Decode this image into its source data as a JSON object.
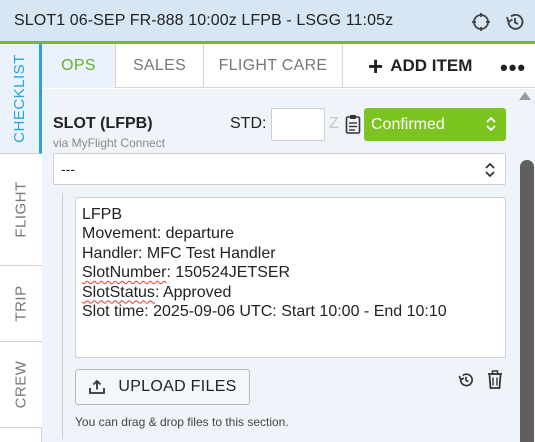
{
  "header": {
    "title": "SLOT1  06-SEP  FR-888 10:00z LFPB - LSGG 11:05z",
    "icons": [
      "crosshair-icon",
      "history-icon"
    ],
    "accent_color": "#7cb342"
  },
  "side_tabs": [
    {
      "label": "CHECKLIST",
      "active": true
    },
    {
      "label": "FLIGHT",
      "active": false
    },
    {
      "label": "TRIP",
      "active": false
    },
    {
      "label": "CREW",
      "active": false
    }
  ],
  "top_tabs": [
    {
      "label": "OPS",
      "active": true
    },
    {
      "label": "SALES",
      "active": false
    },
    {
      "label": "FLIGHT CARE",
      "active": false
    }
  ],
  "toolbar": {
    "add_item_label": "ADD ITEM",
    "more_icon": "more-horizontal-icon"
  },
  "slot": {
    "title": "SLOT (LFPB)",
    "subtitle": "via MyFlight Connect",
    "std_label": "STD:",
    "std_value": "",
    "zulu_label": "Z",
    "status": "Confirmed",
    "status_color": "#7cc520",
    "secondary_select": "---"
  },
  "notes": {
    "lines": [
      "LFPB",
      "Movement: departure",
      "Handler: MFC Test Handler",
      "SlotNumber: 150524JETSER",
      "SlotStatus: Approved",
      "Slot time: 2025-09-06 UTC: Start 10:00 - End 10:10"
    ],
    "spellcheck_words": [
      "SlotNumber",
      "SlotStatus"
    ]
  },
  "upload": {
    "button_label": "UPLOAD FILES",
    "hint": "You can drag & drop files to this section."
  },
  "colors": {
    "active_tab_text": "#6aab2e",
    "side_tab_active": "#29a3d9",
    "header_bg": "#d6e6f3"
  }
}
